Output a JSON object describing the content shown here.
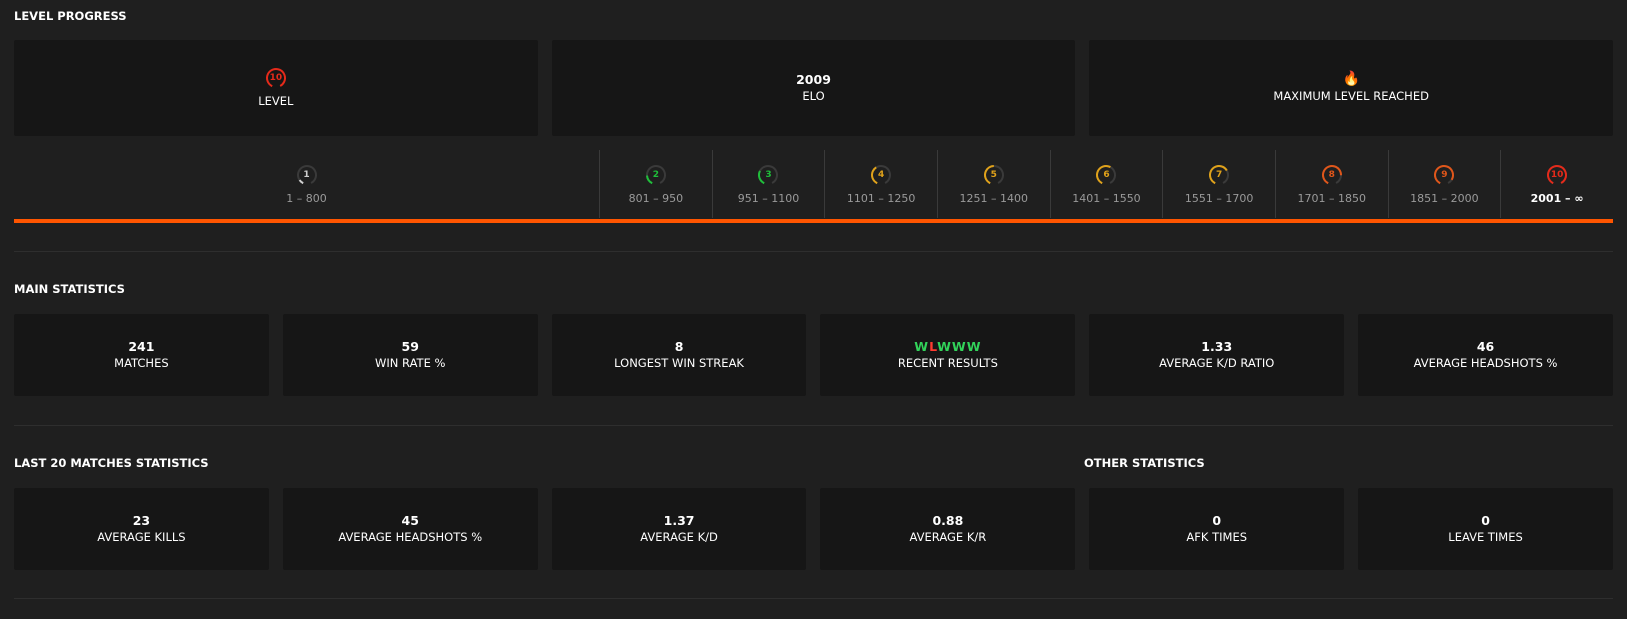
{
  "level_progress": {
    "title": "LEVEL PROGRESS",
    "level_card": {
      "value": "10",
      "label": "LEVEL",
      "color": "#e52a1a"
    },
    "elo_card": {
      "value": "2009",
      "label": "ELO"
    },
    "max_card": {
      "icon": "fire-icon",
      "label": "MAXIMUM LEVEL REACHED"
    },
    "levels": [
      {
        "level": "1",
        "range": "1 – 800",
        "color": "#cfcfcf"
      },
      {
        "level": "2",
        "range": "801 – 950",
        "color": "#1fbf3a"
      },
      {
        "level": "3",
        "range": "951 – 1100",
        "color": "#1fbf3a"
      },
      {
        "level": "4",
        "range": "1101 – 1250",
        "color": "#e0a21a"
      },
      {
        "level": "5",
        "range": "1251 – 1400",
        "color": "#e0a21a"
      },
      {
        "level": "6",
        "range": "1401 – 1550",
        "color": "#e0a21a"
      },
      {
        "level": "7",
        "range": "1551 – 1700",
        "color": "#e0a21a"
      },
      {
        "level": "8",
        "range": "1701 – 1850",
        "color": "#e0561a"
      },
      {
        "level": "9",
        "range": "1851 – 2000",
        "color": "#e0561a"
      },
      {
        "level": "10",
        "range": "2001 – ∞",
        "color": "#e52a1a"
      }
    ],
    "current_level_index": 9
  },
  "main_statistics": {
    "title": "MAIN STATISTICS",
    "cards": [
      {
        "value": "241",
        "label": "MATCHES"
      },
      {
        "value": "59",
        "label": "WIN RATE %"
      },
      {
        "value": "8",
        "label": "LONGEST WIN STREAK"
      },
      {
        "value": "WLWWW",
        "label": "RECENT RESULTS"
      },
      {
        "value": "1.33",
        "label": "AVERAGE K/D RATIO"
      },
      {
        "value": "46",
        "label": "AVERAGE HEADSHOTS %"
      }
    ],
    "recent_results": [
      "W",
      "L",
      "W",
      "W",
      "W"
    ],
    "win_color": "#32d35a",
    "loss_color": "#ff3b30"
  },
  "last20_statistics": {
    "title": "LAST 20 MATCHES STATISTICS",
    "cards": [
      {
        "value": "23",
        "label": "AVERAGE KILLS"
      },
      {
        "value": "45",
        "label": "AVERAGE HEADSHOTS %"
      },
      {
        "value": "1.37",
        "label": "AVERAGE K/D"
      },
      {
        "value": "0.88",
        "label": "AVERAGE K/R"
      }
    ]
  },
  "other_statistics": {
    "title": "OTHER STATISTICS",
    "cards": [
      {
        "value": "0",
        "label": "AFK TIMES"
      },
      {
        "value": "0",
        "label": "LEAVE TIMES"
      }
    ]
  },
  "accent_color": "#ff5500"
}
